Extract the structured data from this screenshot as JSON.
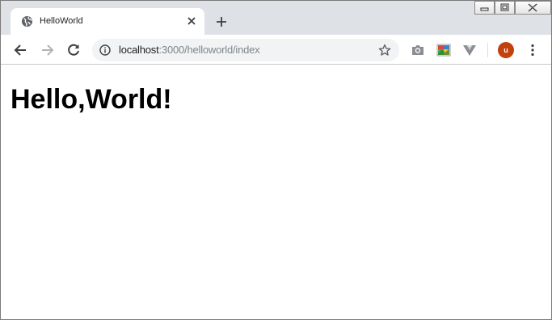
{
  "browser": {
    "tab": {
      "title": "HelloWorld",
      "favicon": "globe-icon"
    },
    "new_tab_icon": "plus-icon",
    "window_controls": [
      "minimize-icon",
      "restore-icon",
      "close-icon"
    ],
    "toolbar": {
      "back_icon": "arrow-left-icon",
      "forward_icon": "arrow-right-icon",
      "reload_icon": "reload-icon",
      "url_host": "localhost",
      "url_path": ":3000/helloworld/index",
      "bookmark_icon": "star-icon",
      "extensions": [
        "camera-icon",
        "image-extension-icon",
        "vue-devtools-icon"
      ],
      "profile_initial": "u",
      "menu_icon": "kebab-menu-icon"
    }
  },
  "page": {
    "heading": "Hello,World!"
  },
  "colors": {
    "titlebar": "#dee1e6",
    "omnibox": "#f1f3f4",
    "avatar": "#c2410c"
  }
}
